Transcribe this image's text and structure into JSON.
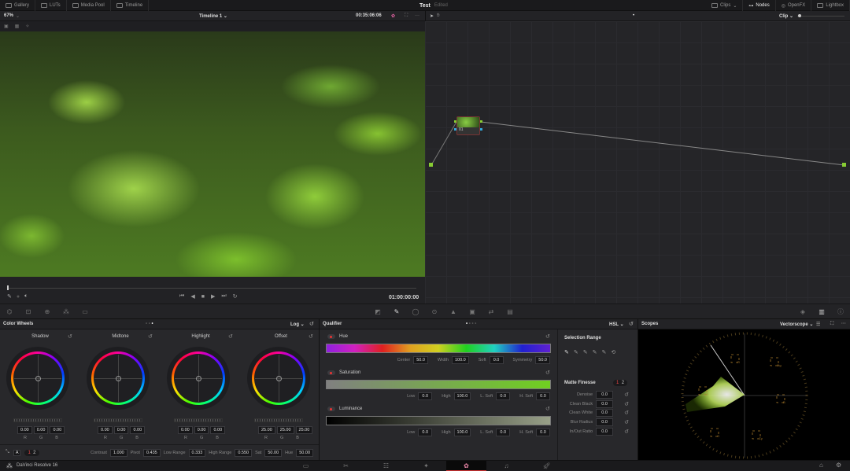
{
  "topbar": {
    "items": [
      {
        "label": "Gallery",
        "icon": "gallery-icon"
      },
      {
        "label": "LUTs",
        "icon": "luts-icon"
      },
      {
        "label": "Media Pool",
        "icon": "media-pool-icon"
      },
      {
        "label": "Timeline",
        "icon": "timeline-icon"
      }
    ],
    "project": "Test",
    "status": "Edited",
    "right": [
      {
        "label": "Clips",
        "icon": "clips-icon"
      },
      {
        "label": "Nodes",
        "icon": "nodes-icon"
      },
      {
        "label": "OpenFX",
        "icon": "openfx-icon"
      },
      {
        "label": "Lightbox",
        "icon": "lightbox-icon"
      }
    ]
  },
  "viewer": {
    "zoom": "67%",
    "timeline": "Timeline 1",
    "timecode": "00:35:06:06",
    "playhead_timecode": "01:00:00:00",
    "playhead_progress": 0
  },
  "nodes": {
    "mode": "Clip",
    "node_label": "01"
  },
  "color_wheels": {
    "title": "Color Wheels",
    "mode": "Log",
    "wheels": [
      {
        "name": "Shadow",
        "r": "0.00",
        "g": "0.00",
        "b": "0.00"
      },
      {
        "name": "Midtone",
        "r": "0.00",
        "g": "0.00",
        "b": "0.00"
      },
      {
        "name": "Highlight",
        "r": "0.00",
        "g": "0.00",
        "b": "0.00"
      },
      {
        "name": "Offset",
        "r": "25.00",
        "g": "25.00",
        "b": "25.00"
      }
    ],
    "channel_labels": [
      "R",
      "G",
      "B"
    ],
    "pages": [
      "1",
      "2"
    ],
    "params": [
      {
        "label": "Contrast",
        "value": "1.000"
      },
      {
        "label": "Pivot",
        "value": "0.435"
      },
      {
        "label": "Low Range",
        "value": "0.333"
      },
      {
        "label": "High Range",
        "value": "0.550"
      },
      {
        "label": "Sat",
        "value": "50.00"
      },
      {
        "label": "Hue",
        "value": "50.00"
      }
    ]
  },
  "qualifier": {
    "title": "Qualifier",
    "mode": "HSL",
    "sections": [
      {
        "name": "Hue",
        "fields": [
          {
            "label": "Center",
            "value": "50.0"
          },
          {
            "label": "Width",
            "value": "100.0"
          },
          {
            "label": "Soft",
            "value": "0.0"
          },
          {
            "label": "Symmetry",
            "value": "50.0"
          }
        ]
      },
      {
        "name": "Saturation",
        "fields": [
          {
            "label": "Low",
            "value": "0.0"
          },
          {
            "label": "High",
            "value": "100.0"
          },
          {
            "label": "L. Soft",
            "value": "0.0"
          },
          {
            "label": "H. Soft",
            "value": "0.0"
          }
        ]
      },
      {
        "name": "Luminance",
        "fields": [
          {
            "label": "Low",
            "value": "0.0"
          },
          {
            "label": "High",
            "value": "100.0"
          },
          {
            "label": "L. Soft",
            "value": "0.0"
          },
          {
            "label": "H. Soft",
            "value": "0.0"
          }
        ]
      }
    ],
    "selection_range": "Selection Range",
    "matte_finesse": "Matte Finesse",
    "matte_pages": [
      "1",
      "2"
    ],
    "matte_fields": [
      {
        "label": "Denoise",
        "value": "0.0"
      },
      {
        "label": "Clean Black",
        "value": "0.0"
      },
      {
        "label": "Clean White",
        "value": "0.0"
      },
      {
        "label": "Blur Radius",
        "value": "0.0"
      },
      {
        "label": "In/Out Ratio",
        "value": "0.0"
      }
    ]
  },
  "scopes": {
    "title": "Scopes",
    "mode": "Vectorscope",
    "targets": [
      "R",
      "Mg",
      "B",
      "Cy",
      "G",
      "Yl"
    ]
  },
  "pagebar": {
    "app": "DaVinci Resolve 16",
    "pages": [
      "media",
      "cut",
      "edit",
      "fusion",
      "color",
      "fairlight",
      "deliver"
    ],
    "active": "color"
  }
}
